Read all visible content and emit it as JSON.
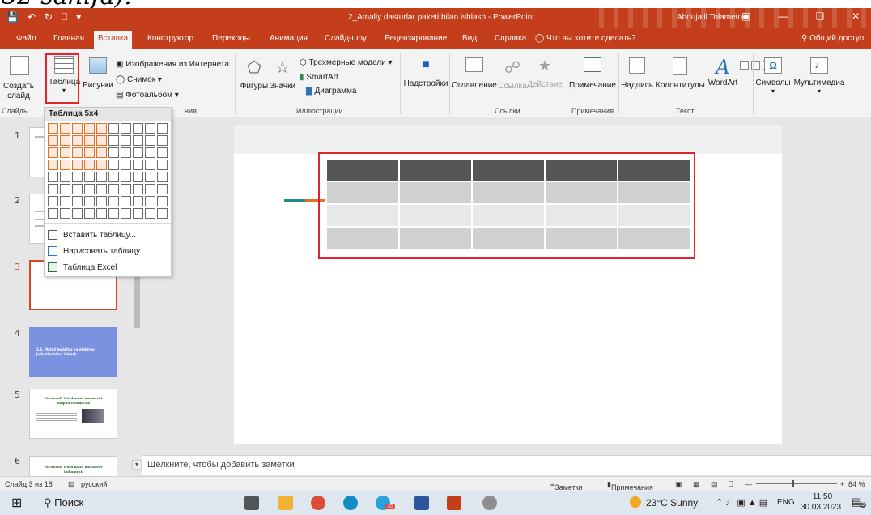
{
  "overlay_text": "32-sahifa).",
  "window": {
    "title": "2_Amaliy dasturlar paketi bilan ishlash  -  PowerPoint",
    "user": "Abdujalil Tolametov"
  },
  "tabs": [
    "Файл",
    "Главная",
    "Вставка",
    "Конструктор",
    "Переходы",
    "Анимация",
    "Слайд-шоу",
    "Рецензирование",
    "Вид",
    "Справка"
  ],
  "tell_me": "Что вы хотите сделать?",
  "share": "Общий доступ",
  "ribbon": {
    "slides": {
      "new_slide": "Создать слайд",
      "group": "Слайды"
    },
    "tables": {
      "table": "Таблица"
    },
    "images": {
      "pictures": "Рисунки",
      "online": "Изображения из Интернета",
      "screenshot": "Снимок",
      "album": "Фотоальбом",
      "group": "ния"
    },
    "illustrations": {
      "shapes": "Фигуры",
      "icons": "Значки",
      "models": "Трехмерные модели",
      "smartart": "SmartArt",
      "chart": "Диаграмма",
      "group": "Иллюстрации"
    },
    "addins": {
      "label": "Надстройки"
    },
    "links": {
      "zoom": "Оглавление",
      "link": "Ссылка",
      "action": "Действие",
      "group": "Ссылки"
    },
    "comments": {
      "comment": "Примечание",
      "group": "Примечания"
    },
    "text": {
      "textbox": "Надпись",
      "headerfooter": "Колонтитулы",
      "wordart": "WordArt",
      "group": "Текст"
    },
    "symbols": {
      "label": "Символы"
    },
    "media": {
      "label": "Мультимедиа"
    }
  },
  "dropdown": {
    "header": "Таблица 5x4",
    "cols": 10,
    "rows": 8,
    "sel_cols": 5,
    "sel_rows": 4,
    "items": [
      "Вставить таблицу...",
      "Нарисовать таблицу",
      "Таблица Excel"
    ]
  },
  "thumbnails": [
    "1",
    "2",
    "3",
    "4",
    "5",
    "6"
  ],
  "thumb4_text": "2.3. Matnli hujjatlar va elektron jadvallar bilan ishlash",
  "thumb5_title": "Microsoft Word matn muharriri haqida tushuncha",
  "thumb6_title": "Microsoft Word matn muharriri imkoniyati",
  "notes_placeholder": "Щелкните, чтобы добавить заметки",
  "status": {
    "slide_info": "Слайд 3 из 18",
    "language": "русский",
    "notes": "Заметки",
    "comments": "Примечания",
    "zoom": "84 %"
  },
  "taskbar": {
    "search": "Поиск",
    "weather": "23°C  Sunny",
    "lang": "ENG",
    "time": "11:50",
    "date": "30.03.2023",
    "badge": "35",
    "notif": "3"
  },
  "colors": {
    "accent": "#c43e1c",
    "highlight": "#e0232e",
    "table_header": "#555555"
  }
}
